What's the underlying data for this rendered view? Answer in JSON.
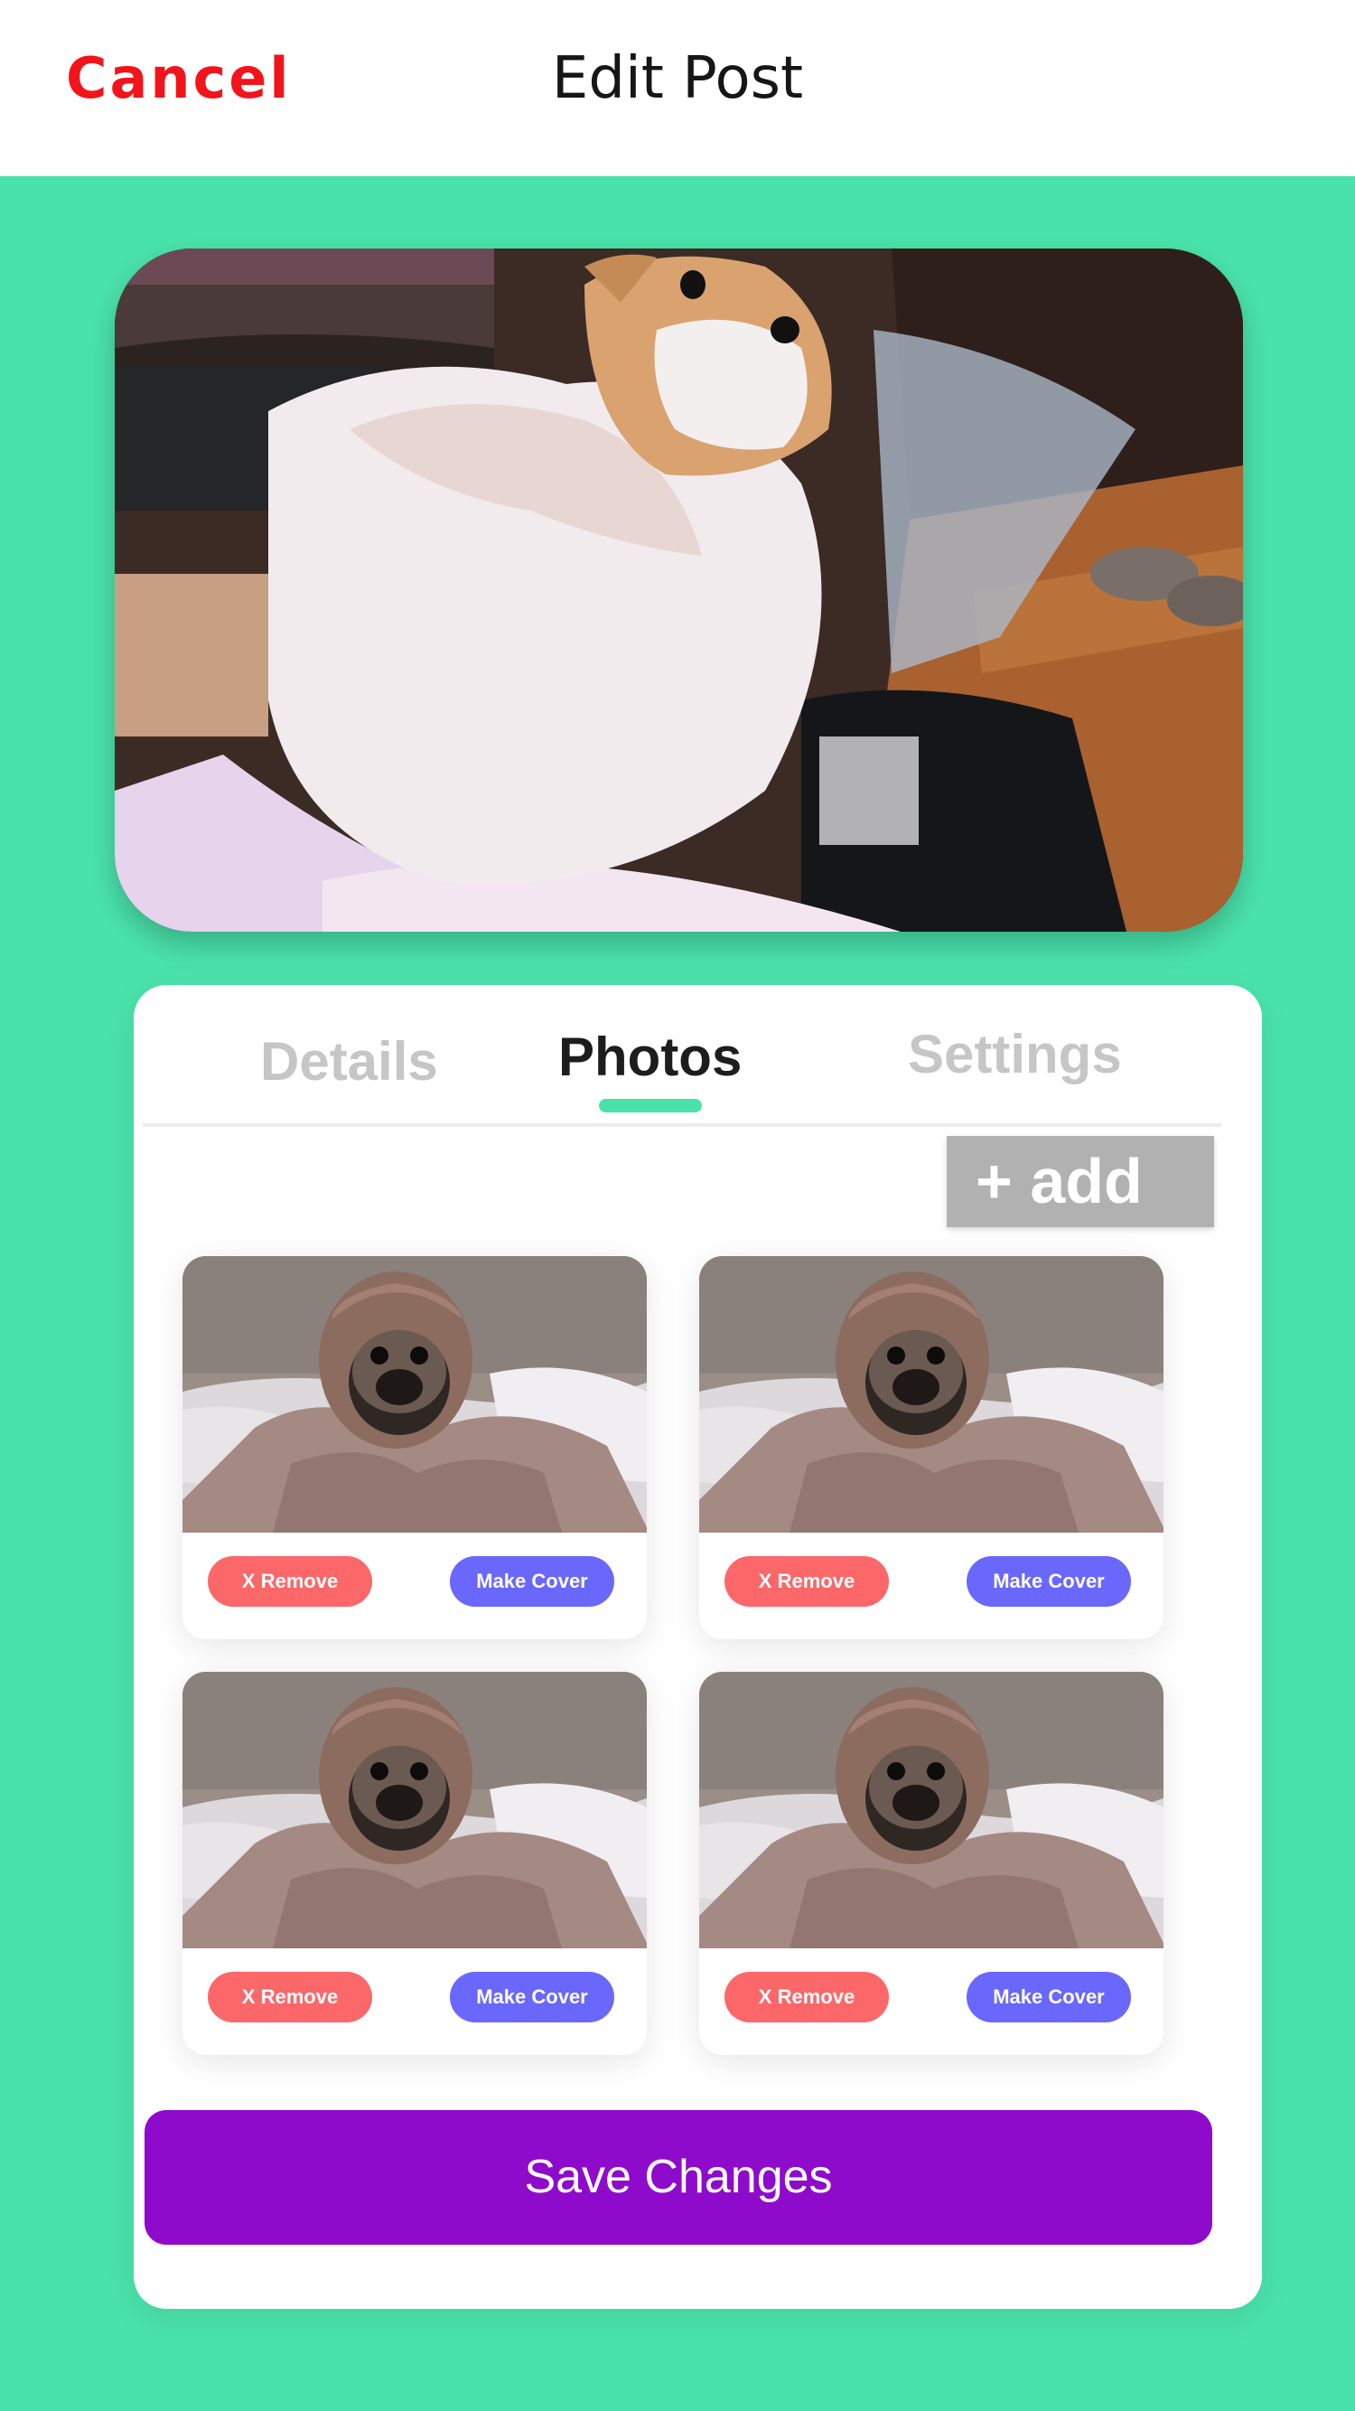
{
  "header": {
    "cancel_label": "Cancel",
    "title": "Edit Post"
  },
  "hero": {
    "image": "pomeranian-dog-photo"
  },
  "tabs": [
    {
      "label": "Details",
      "active": false
    },
    {
      "label": "Photos",
      "active": true
    },
    {
      "label": "Settings",
      "active": false
    }
  ],
  "photos": {
    "add_label": "+ add",
    "items": [
      {
        "image": "pug-in-blanket-photo",
        "remove_label": "X  Remove",
        "cover_label": "Make Cover"
      },
      {
        "image": "pug-in-blanket-photo",
        "remove_label": "X  Remove",
        "cover_label": "Make Cover"
      },
      {
        "image": "pug-in-blanket-photo",
        "remove_label": "X  Remove",
        "cover_label": "Make Cover"
      },
      {
        "image": "pug-in-blanket-photo",
        "remove_label": "X  Remove",
        "cover_label": "Make Cover"
      }
    ]
  },
  "save_label": "Save Changes",
  "colors": {
    "background": "#4ae2ab",
    "cancel": "#f2141b",
    "remove": "#fc6869",
    "make_cover": "#6a67fd",
    "save": "#8f0bcb",
    "add_button": "#b1b1b1"
  }
}
